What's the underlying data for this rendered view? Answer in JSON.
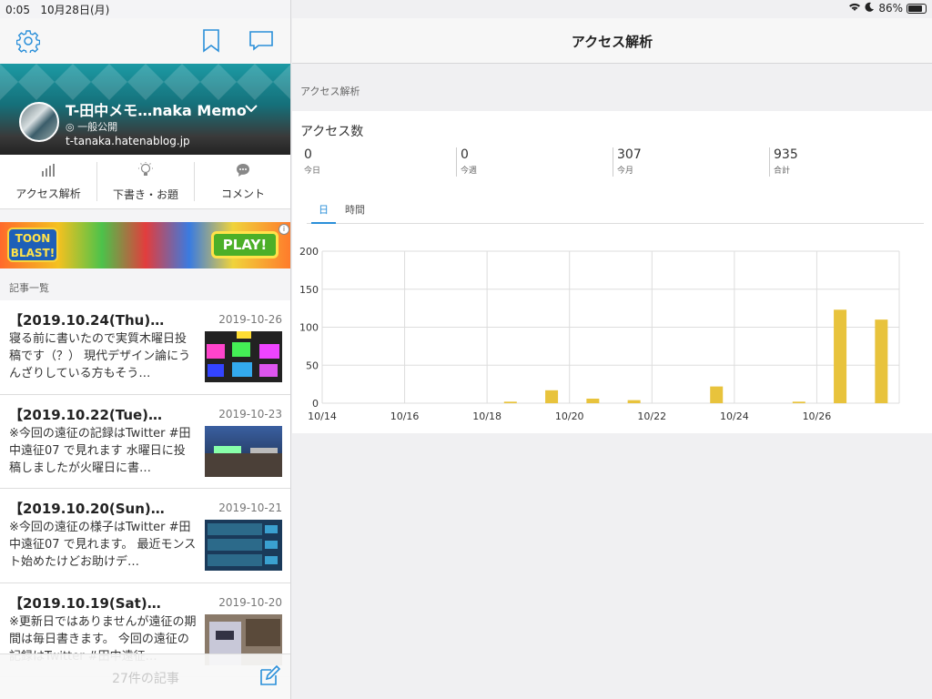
{
  "status_bar": {
    "time": "0:05",
    "date": "10月28日(月)",
    "battery": "86%",
    "battery_level": 0.86
  },
  "left_header": {
    "settings_icon": "gear-icon",
    "bookmark_icon": "bookmark-icon",
    "comment_icon": "speech-bubble-icon"
  },
  "blog": {
    "title": "T-田中メモ…naka Memo",
    "visibility": "一般公開",
    "url": "t-tanaka.hatenablog.jp"
  },
  "menu": [
    {
      "label": "アクセス解析",
      "icon": "bar-chart-icon"
    },
    {
      "label": "下書き・お題",
      "icon": "lightbulb-icon"
    },
    {
      "label": "コメント",
      "icon": "speech-bubble-icon"
    }
  ],
  "ad": {
    "brand": "TOON BLAST!",
    "cta": "PLAY!",
    "badge": "i"
  },
  "articles_label": "記事一覧",
  "articles": [
    {
      "title": "【2019.10.24(Thu)…",
      "date": "2019-10-26",
      "snippet": "寝る前に書いたので実質木曜日投稿です（？） 現代デザイン論にうんざりしている方もそう…"
    },
    {
      "title": "【2019.10.22(Tue)…",
      "date": "2019-10-23",
      "snippet": "※今回の遠征の記録はTwitter #田中遠征07 で見れます 水曜日に投稿しましたが火曜日に書…"
    },
    {
      "title": "【2019.10.20(Sun)…",
      "date": "2019-10-21",
      "snippet": "※今回の遠征の様子はTwitter #田中遠征07 で見れます。 最近モンスト始めたけどお助けデ…"
    },
    {
      "title": "【2019.10.19(Sat)…",
      "date": "2019-10-20",
      "snippet": "※更新日ではありませんが遠征の期間は毎日書きます。 今回の遠征の記録はTwitter #田中遠征…"
    }
  ],
  "footer": {
    "count": "27件の記事",
    "compose_icon": "compose-icon"
  },
  "right": {
    "title": "アクセス解析",
    "section_label": "アクセス解析",
    "card_title": "アクセス数",
    "stats": [
      {
        "value": "0",
        "label": "今日"
      },
      {
        "value": "0",
        "label": "今週"
      },
      {
        "value": "307",
        "label": "今月"
      },
      {
        "value": "935",
        "label": "合計"
      }
    ],
    "tabs": [
      "日",
      "時間"
    ]
  },
  "chart_data": {
    "type": "bar",
    "color": "#e8c33c",
    "ylim": [
      0,
      200
    ],
    "yticks": [
      0,
      50,
      100,
      150,
      200
    ],
    "xtick_labels": [
      "10/14",
      "10/16",
      "10/18",
      "10/20",
      "10/22",
      "10/24",
      "10/26"
    ],
    "categories": [
      "10/14",
      "10/15",
      "10/16",
      "10/17",
      "10/18",
      "10/19",
      "10/20",
      "10/21",
      "10/22",
      "10/23",
      "10/24",
      "10/25",
      "10/26",
      "10/27"
    ],
    "values": [
      0,
      0,
      0,
      0,
      2,
      17,
      6,
      4,
      0,
      22,
      0,
      2,
      123,
      110
    ]
  }
}
